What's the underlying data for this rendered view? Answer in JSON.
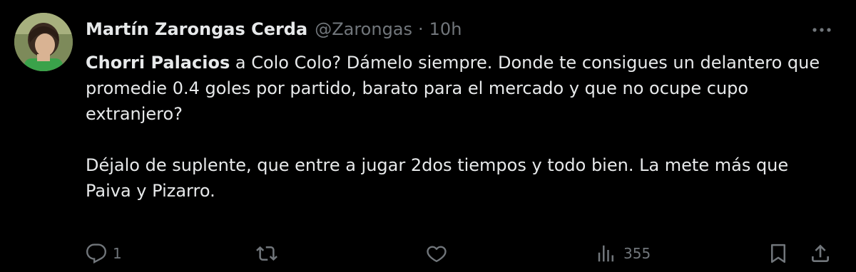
{
  "tweet": {
    "author": {
      "display_name": "Martín Zarongas Cerda",
      "handle": "@Zarongas",
      "separator": "·",
      "time": "10h",
      "avatar_icon": "user-avatar-photo"
    },
    "more_icon": "more-horizontal-icon",
    "body": {
      "mention": "Chorri Palacios",
      "paragraph1_rest": " a Colo Colo? Dámelo siempre. Donde te consigues un delantero que promedie 0.4 goles por partido, barato para el mercado y que no ocupe cupo extranjero?",
      "paragraph2": "Déjalo de suplente, que entre a jugar 2dos tiempos y todo bien. La mete más que Paiva y Pizarro."
    },
    "actions": {
      "reply": {
        "icon": "reply-icon",
        "count": "1"
      },
      "retweet": {
        "icon": "retweet-icon",
        "count": ""
      },
      "like": {
        "icon": "heart-icon",
        "count": ""
      },
      "views": {
        "icon": "analytics-icon",
        "count": "355"
      },
      "bookmark": {
        "icon": "bookmark-icon"
      },
      "share": {
        "icon": "share-icon"
      }
    },
    "colors": {
      "background": "#000000",
      "text_primary": "#e7e9ea",
      "text_secondary": "#71767b"
    }
  }
}
